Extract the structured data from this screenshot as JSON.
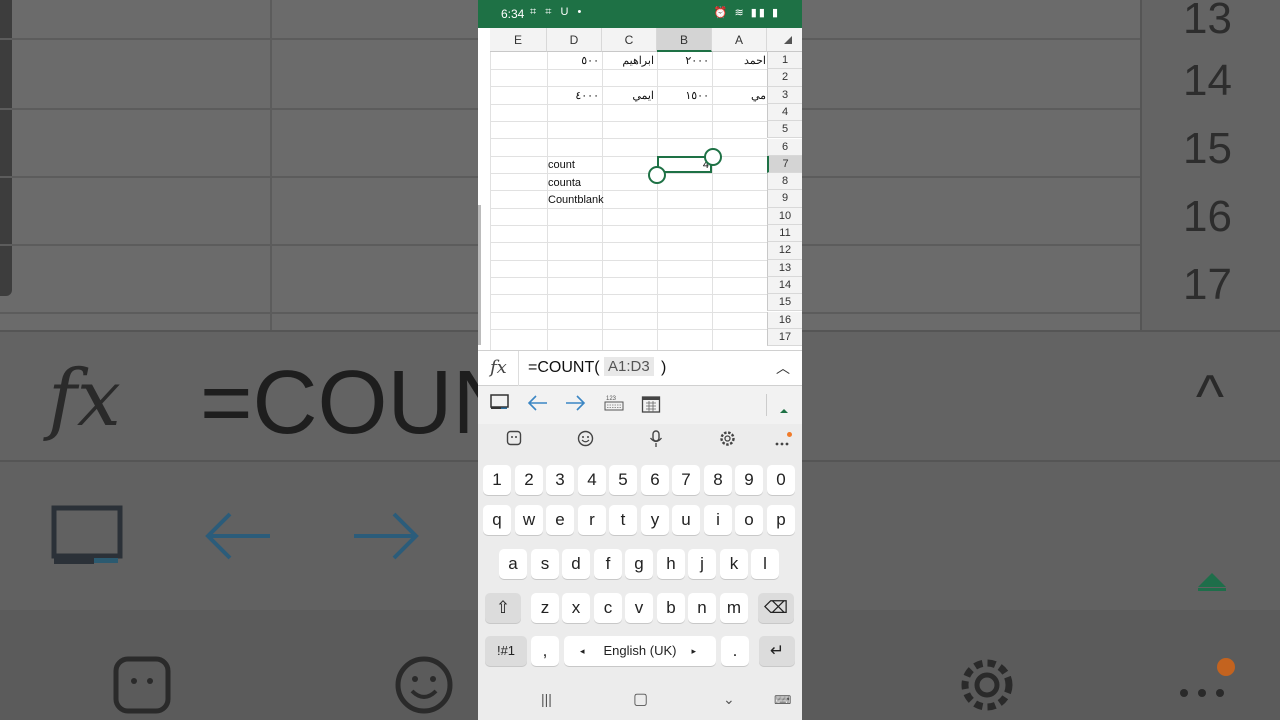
{
  "background": {
    "formula": "=COUNT(",
    "row_numbers": [
      "13",
      "14",
      "15",
      "16",
      "17"
    ]
  },
  "status_bar": {
    "time": "6:34",
    "left_icons": "⌗ ⌗ U •",
    "right_icons": "⏰ ≋ ▮▮ ▮",
    "accent": "#1e7145"
  },
  "columns": [
    "E",
    "D",
    "C",
    "B",
    "A"
  ],
  "selected_column": "B",
  "rows": [
    "1",
    "2",
    "3",
    "4",
    "5",
    "6",
    "7",
    "8",
    "9",
    "10",
    "11",
    "12",
    "13",
    "14",
    "15",
    "16",
    "17"
  ],
  "selected_row": "7",
  "cells": {
    "a1": "احمد",
    "b1": "٢٠٠٠",
    "c1": "ابراهيم",
    "d1": "٥٠٠",
    "a3": "مي",
    "b3": "١٥٠٠",
    "c3": "ايمي",
    "d3": "٤٠٠٠",
    "b7": "4",
    "d7": "count",
    "d8": "counta",
    "d9": "Countblank"
  },
  "formula_bar": {
    "fx": "fx",
    "formula_start": "=COUNT(",
    "reference": "A1:D3",
    "formula_end": ")"
  },
  "toolbar": {
    "icons": [
      "sheet-view-icon",
      "arrow-left-icon",
      "arrow-right-icon",
      "number-keyboard-icon",
      "calendar-icon",
      "collapse-icon"
    ]
  },
  "keyboard": {
    "top_icons": [
      "sticker-icon",
      "emoji-icon",
      "mic-icon",
      "settings-icon",
      "more-icon"
    ],
    "row_numbers": [
      "1",
      "2",
      "3",
      "4",
      "5",
      "6",
      "7",
      "8",
      "9",
      "0"
    ],
    "row_q": [
      "q",
      "w",
      "e",
      "r",
      "t",
      "y",
      "u",
      "i",
      "o",
      "p"
    ],
    "row_a": [
      "a",
      "s",
      "d",
      "f",
      "g",
      "h",
      "j",
      "k",
      "l"
    ],
    "row_z": [
      "z",
      "x",
      "c",
      "v",
      "b",
      "n",
      "m"
    ],
    "symbols_key": "!#1",
    "comma_key": ",",
    "space_label": "English (UK)",
    "period_key": "."
  },
  "nav_bar": {
    "recent": "|||",
    "home": "▢",
    "back": "⌄",
    "keyboard": "⌨"
  }
}
